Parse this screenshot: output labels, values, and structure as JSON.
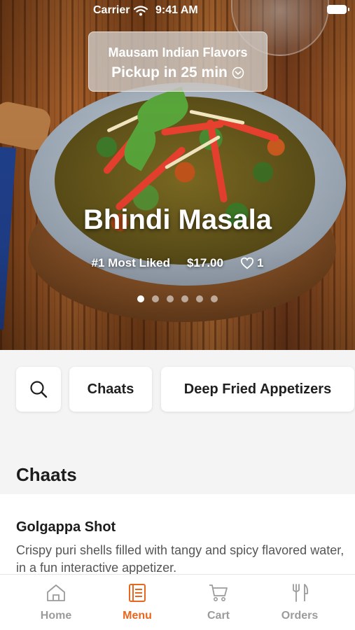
{
  "status_bar": {
    "carrier": "Carrier",
    "time": "9:41 AM"
  },
  "pickup": {
    "restaurant": "Mausam Indian Flavors",
    "label": "Pickup in 25 min"
  },
  "hero": {
    "dish_name": "Bhindi Masala",
    "rank": "#1 Most Liked",
    "price": "$17.00",
    "likes": "1",
    "carousel_total": 6,
    "carousel_active_index": 0
  },
  "categories": [
    {
      "icon": "search-icon"
    },
    {
      "label": "Chaats"
    },
    {
      "label": "Deep Fried Appetizers"
    }
  ],
  "section": {
    "title": "Chaats",
    "items": [
      {
        "name": "Golgappa Shot",
        "description": "Crispy puri shells filled with tangy and spicy flavored water, in a fun interactive appetizer."
      }
    ]
  },
  "tabs": [
    {
      "label": "Home",
      "icon": "home-icon",
      "active": false
    },
    {
      "label": "Menu",
      "icon": "menu-icon",
      "active": true
    },
    {
      "label": "Cart",
      "icon": "cart-icon",
      "active": false
    },
    {
      "label": "Orders",
      "icon": "fork-knife-icon",
      "active": false
    }
  ],
  "colors": {
    "accent": "#e8671e",
    "inactive_tab": "#9b9b9b"
  }
}
